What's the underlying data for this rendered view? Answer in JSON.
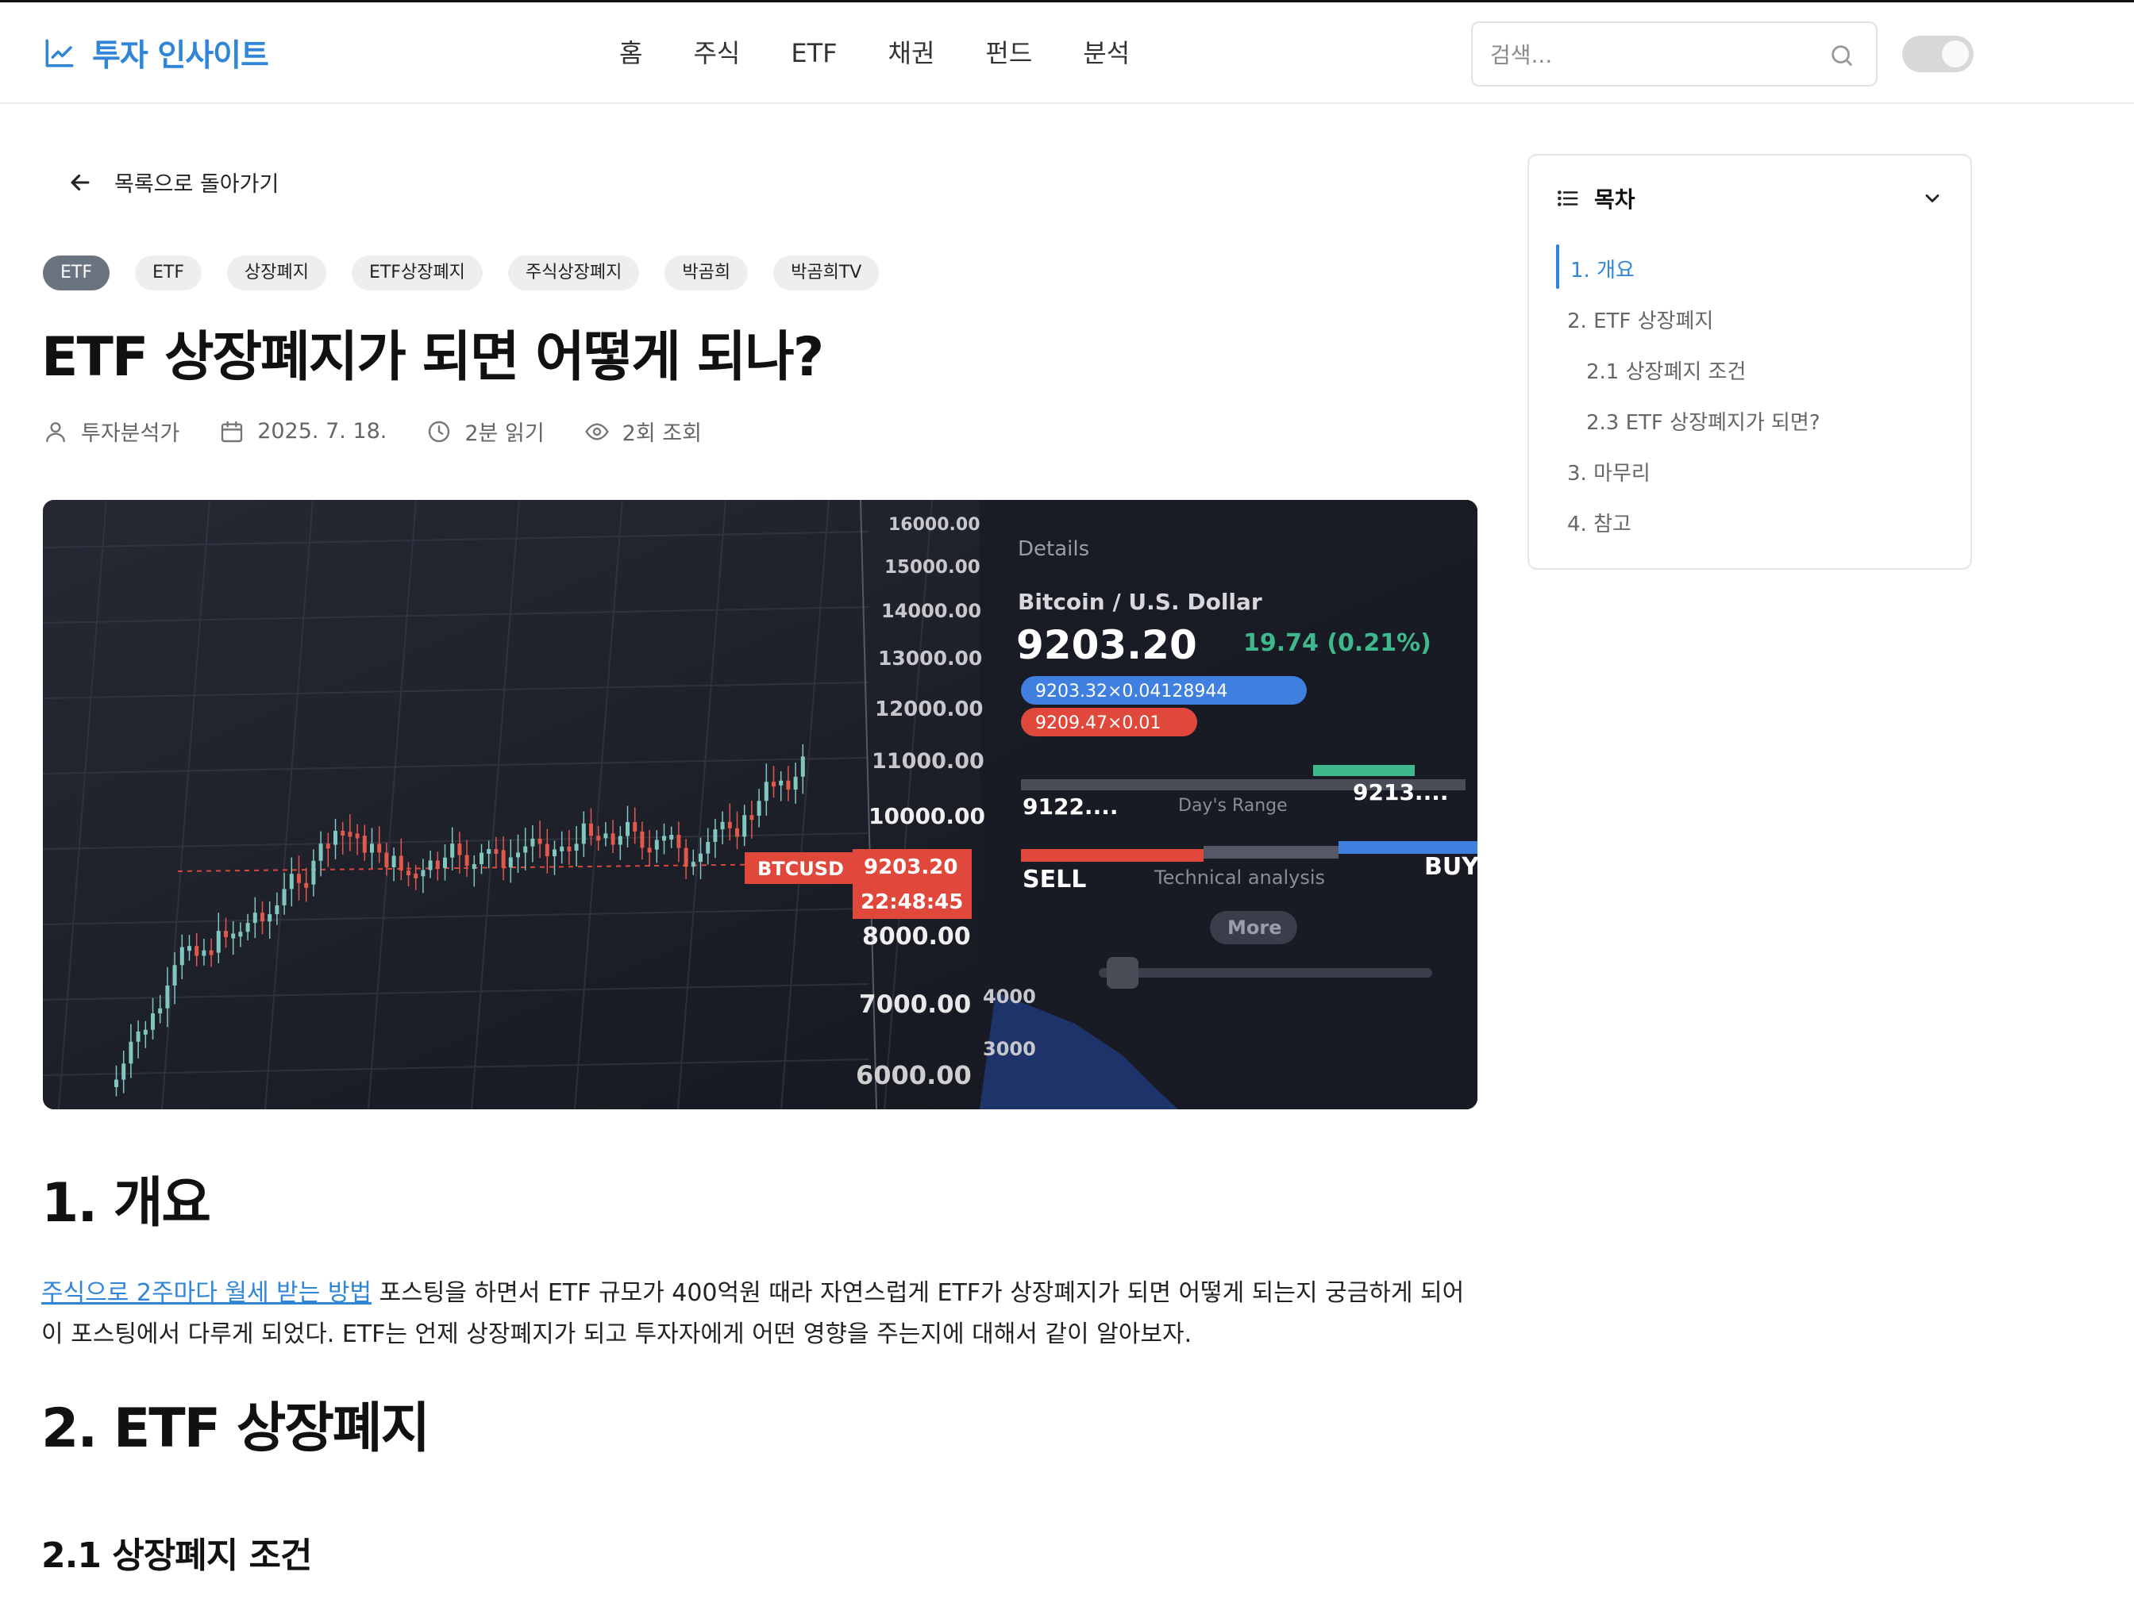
{
  "header": {
    "logo_text": "투자 인사이트",
    "nav": [
      "홈",
      "주식",
      "ETF",
      "채권",
      "펀드",
      "분석"
    ],
    "search_placeholder": "검색...",
    "accent_color": "#2f86d8"
  },
  "back_link": {
    "label": "목록으로 돌아가기"
  },
  "tags": [
    "ETF",
    "ETF",
    "상장폐지",
    "ETF상장폐지",
    "주식상장폐지",
    "박곰희",
    "박곰희TV"
  ],
  "article": {
    "title": "ETF 상장폐지가 되면 어떻게 되나?",
    "meta": {
      "author": "투자분석가",
      "date": "2025. 7. 18.",
      "read_time": "2분 읽기",
      "views": "2회 조회"
    },
    "hero_image": {
      "price_axis": [
        "16000.00",
        "15000.00",
        "14000.00",
        "13000.00",
        "12000.00",
        "11000.00",
        "10000.00",
        "8000.00",
        "7000.00",
        "6000.00"
      ],
      "ticker": "BTCUSD",
      "price_tag": "9203.20",
      "time_tag": "22:48:45",
      "details_label": "Details",
      "pair_name": "Bitcoin / U.S. Dollar",
      "last_price": "9203.20",
      "change": "19.74 (0.21%)",
      "bid": "9203.32×0.04128944",
      "ask": "9209.47×0.01",
      "range_low": "9122....",
      "range_label": "Day's Range",
      "range_high": "9213....",
      "sell_label": "SELL",
      "analysis_label": "Technical analysis",
      "buy_label": "BUY",
      "more_label": "More",
      "depth_axis": [
        "4000",
        "3000"
      ]
    },
    "section1_heading": "1. 개요",
    "section1_link": "주식으로 2주마다 월세 받는 방법",
    "section1_text": " 포스팅을 하면서 ETF 규모가 400억원 때라 자연스럽게 ETF가 상장폐지가 되면 어떻게 되는지 궁금하게 되어 이 포스팅에서 다루게 되었다. ETF는 언제 상장폐지가 되고 투자자에게 어떤 영향을 주는지에 대해서 같이 알아보자.",
    "section2_heading": "2. ETF 상장폐지",
    "section21_heading": "2.1 상장폐지 조건"
  },
  "toc": {
    "title": "목차",
    "items": [
      "1. 개요",
      "2. ETF 상장폐지",
      "2.1 상장폐지 조건",
      "2.3 ETF 상장폐지가 되면?",
      "3. 마무리",
      "4. 참고"
    ],
    "active_index": 0
  }
}
